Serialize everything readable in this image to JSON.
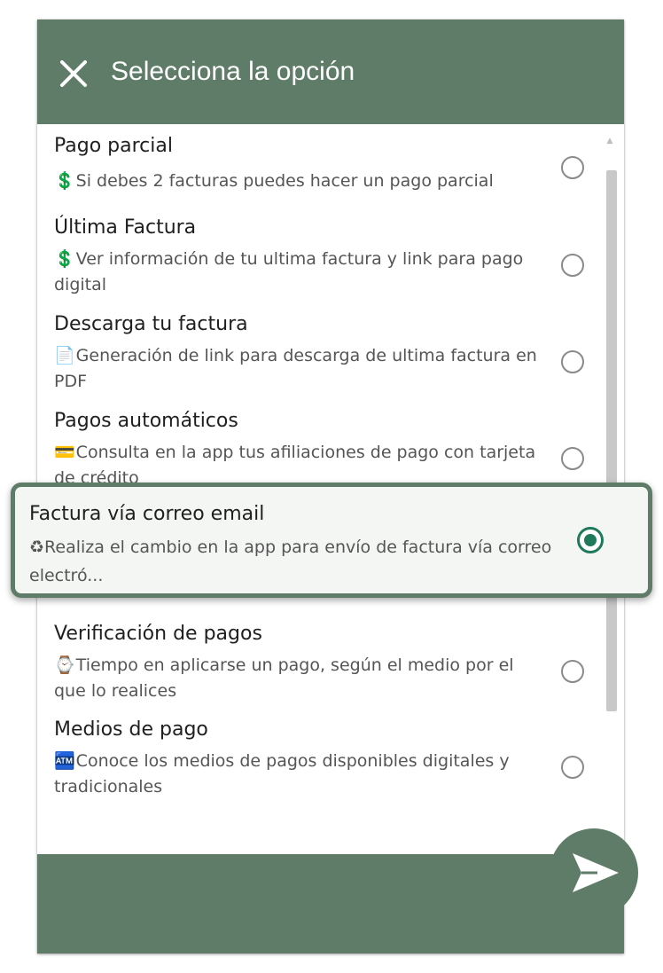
{
  "header": {
    "title": "Selecciona la opción",
    "close_icon": "close-icon"
  },
  "colors": {
    "primary": "#5e7c68",
    "selected_radio": "#1e7a5a",
    "title_text": "#1f1f1f",
    "desc_text": "#555555"
  },
  "options": [
    {
      "title": "Pago parcial",
      "emoji": "💲",
      "desc": "Si debes 2 facturas puedes hacer un pago parcial",
      "selected": false
    },
    {
      "title": "Última Factura",
      "emoji": "💲",
      "desc": "Ver información de tu ultima factura y link para pago digital",
      "selected": false
    },
    {
      "title": "Descarga tu factura",
      "emoji": "📄",
      "desc": "Generación de link para descarga de ultima factura en PDF",
      "selected": false
    },
    {
      "title": "Pagos automáticos",
      "emoji": "💳",
      "desc": "Consulta en la app tus afiliaciones de pago con tarjeta de crédito",
      "selected": false
    },
    {
      "title": "Factura vía correo email",
      "emoji": "♻",
      "desc": "Realiza el cambio en la app para envío de factura vía correo electró...",
      "selected": true
    },
    {
      "title": "Verificación de pagos",
      "emoji": "⌚",
      "desc": "Tiempo en aplicarse un pago, según el medio por el que lo realices",
      "selected": false
    },
    {
      "title": "Medios de pago",
      "emoji": "🏧",
      "desc": "Conoce los medios de pagos disponibles digitales y tradicionales",
      "selected": false
    }
  ],
  "footer": {
    "send_icon": "send-icon"
  }
}
